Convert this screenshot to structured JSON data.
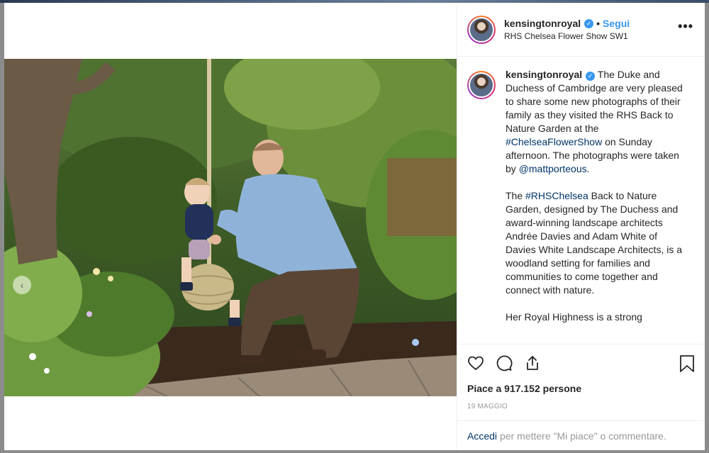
{
  "post": {
    "username": "kensingtonroyal",
    "follow_label": "Segui",
    "separator": "•",
    "location": "RHS Chelsea Flower Show SW1",
    "more_label": "•••"
  },
  "caption": {
    "username": "kensingtonroyal",
    "p1_a": " The Duke and Duchess of Cambridge are very pleased to share some new photographs of their family as they visited the RHS Back to Nature Garden at the ",
    "p1_tag": "#ChelseaFlowerShow",
    "p1_b": " on Sunday afternoon. The photographs were taken by ",
    "p1_mention": "@mattporteous",
    "p1_c": ".",
    "p2_a": "The ",
    "p2_tag": "#RHSChelsea",
    "p2_b": " Back to Nature Garden, designed by The Duchess and award-winning landscape architects Andrée Davies and Adam White of Davies White Landscape Architects, is a woodland setting for families and communities to come together and connect with nature.",
    "p3": "Her Royal Highness is a strong"
  },
  "engagement": {
    "likes_text": "Piace a 917.152 persone",
    "date": "19 MAGGIO"
  },
  "login": {
    "link": "Accedi",
    "rest": "per mettere \"Mi piace\" o commentare."
  },
  "colors": {
    "accent": "#3897f0",
    "link": "#003569",
    "text": "#262626",
    "muted": "#999999"
  },
  "icons": [
    "more-options-icon",
    "verified-badge-icon",
    "heart-icon",
    "comment-icon",
    "share-icon",
    "bookmark-icon",
    "carousel-prev-icon"
  ]
}
